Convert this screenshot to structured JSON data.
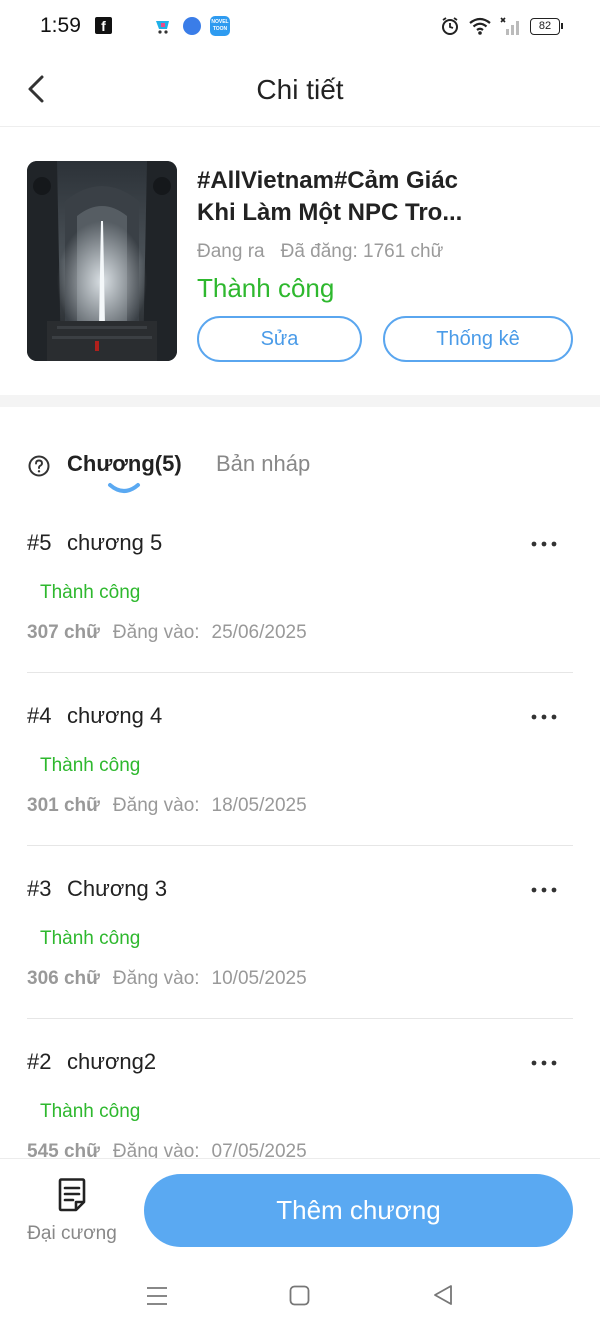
{
  "status_bar": {
    "time": "1:59",
    "fb_glyph": "f",
    "app3_text": "NOVEL TOON",
    "battery": "82",
    "icons": [
      "facebook-icon",
      "app-icon",
      "app-icon",
      "novel-toon-icon",
      "alarm-icon",
      "wifi-icon",
      "signal-icon",
      "battery-icon"
    ]
  },
  "header": {
    "title": "Chi tiết",
    "back_icon": "chevron-left-icon"
  },
  "book": {
    "title_line1": "#AllVietnam#Cảm Giác",
    "title_line2": "Khi Làm Một NPC Tro...",
    "state": "Đang ra",
    "posted_words": "Đã đăng: 1761 chữ",
    "status": "Thành công",
    "edit_label": "Sửa",
    "stats_label": "Thống kê"
  },
  "tabs": {
    "chapters_label": "Chương(5)",
    "draft_label": "Bản nháp",
    "help_icon": "question-circle-icon"
  },
  "chapters": [
    {
      "num": "#5",
      "title": "chương 5",
      "status": "Thành công",
      "words": "307 chữ",
      "posted_label": "Đăng vào:",
      "date": "25/06/2025"
    },
    {
      "num": "#4",
      "title": "chương 4",
      "status": "Thành công",
      "words": "301 chữ",
      "posted_label": "Đăng vào:",
      "date": "18/05/2025"
    },
    {
      "num": "#3",
      "title": "Chương 3",
      "status": "Thành công",
      "words": "306 chữ",
      "posted_label": "Đăng vào:",
      "date": "10/05/2025"
    },
    {
      "num": "#2",
      "title": "chương2",
      "status": "Thành công",
      "words": "545 chữ",
      "posted_label": "Đăng vào:",
      "date": "07/05/2025"
    }
  ],
  "bottom": {
    "outline_label": "Đại cương",
    "add_label": "Thêm chương",
    "outline_icon": "document-list-icon"
  },
  "colors": {
    "accent": "#5aa9f2",
    "success": "#2eb82e",
    "muted": "#999999"
  }
}
